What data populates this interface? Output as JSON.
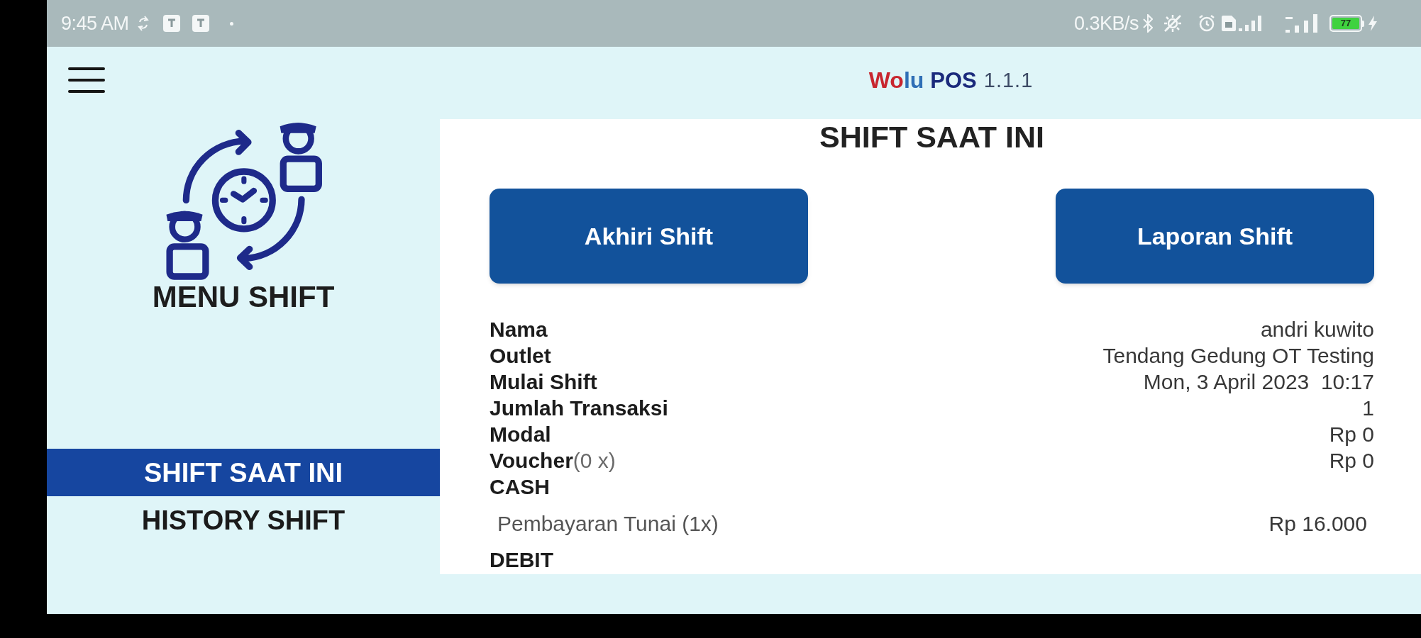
{
  "status_bar": {
    "time": "9:45 AM",
    "network_speed": "0.3KB/s",
    "battery": "77"
  },
  "app_bar": {
    "brand": [
      {
        "text": "Wo",
        "color": "#c8262f"
      },
      {
        "text": "lu",
        "color": "#2f6fb6"
      }
    ],
    "product": "POS",
    "version": "1.1.1"
  },
  "sidebar": {
    "title": "MENU SHIFT",
    "items": [
      {
        "label": "SHIFT SAAT INI",
        "selected": true
      },
      {
        "label": "HISTORY SHIFT",
        "selected": false
      }
    ]
  },
  "content": {
    "title": "SHIFT SAAT INI",
    "buttons": [
      "Akhiri Shift",
      "Laporan Shift"
    ],
    "details": [
      {
        "kind": "field",
        "label": "Nama",
        "value": "andri kuwito"
      },
      {
        "kind": "field",
        "label": "Outlet",
        "value": "Tendang Gedung OT Testing"
      },
      {
        "kind": "field",
        "label": "Mulai Shift",
        "value": "Mon, 3 April 2023  10:17"
      },
      {
        "kind": "field",
        "label": "Jumlah Transaksi",
        "value": "1"
      },
      {
        "kind": "field",
        "label": "Modal",
        "value": "Rp 0"
      },
      {
        "kind": "field",
        "label": "Voucher",
        "note": "(0 x)",
        "value": "Rp 0"
      },
      {
        "kind": "section",
        "label": "CASH"
      },
      {
        "kind": "payment",
        "label": "Pembayaran Tunai (1x)",
        "value": "Rp 16.000"
      },
      {
        "kind": "section",
        "label": "DEBIT"
      }
    ]
  }
}
